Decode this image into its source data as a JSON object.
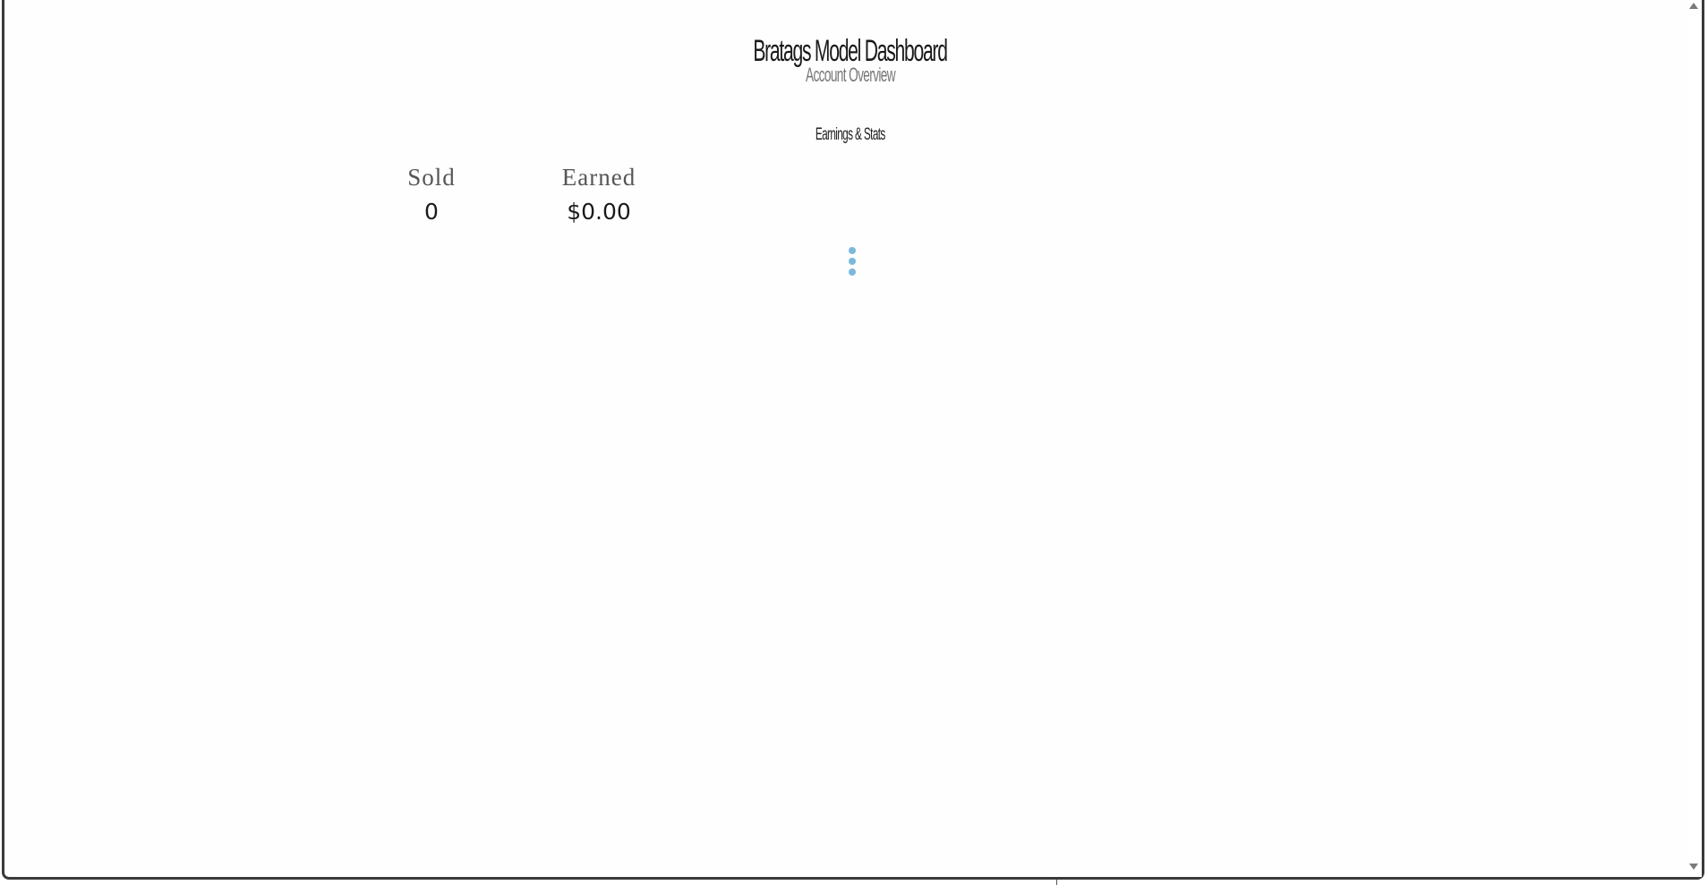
{
  "header": {
    "title": "Bratags Model Dashboard",
    "subtitle": "Account Overview"
  },
  "section": {
    "heading": "Earnings & Stats"
  },
  "stats": {
    "sold_label": "Sold",
    "sold_value": "0",
    "earned_label": "Earned",
    "earned_value": "$0.00"
  },
  "colors": {
    "loader_dot": "#7cb8dc",
    "frame_border": "#3a3a3a"
  },
  "icons": {
    "loader": "loading-dots-icon",
    "scroll_up": "scroll-up-arrow-icon",
    "scroll_down": "scroll-down-arrow-icon"
  }
}
